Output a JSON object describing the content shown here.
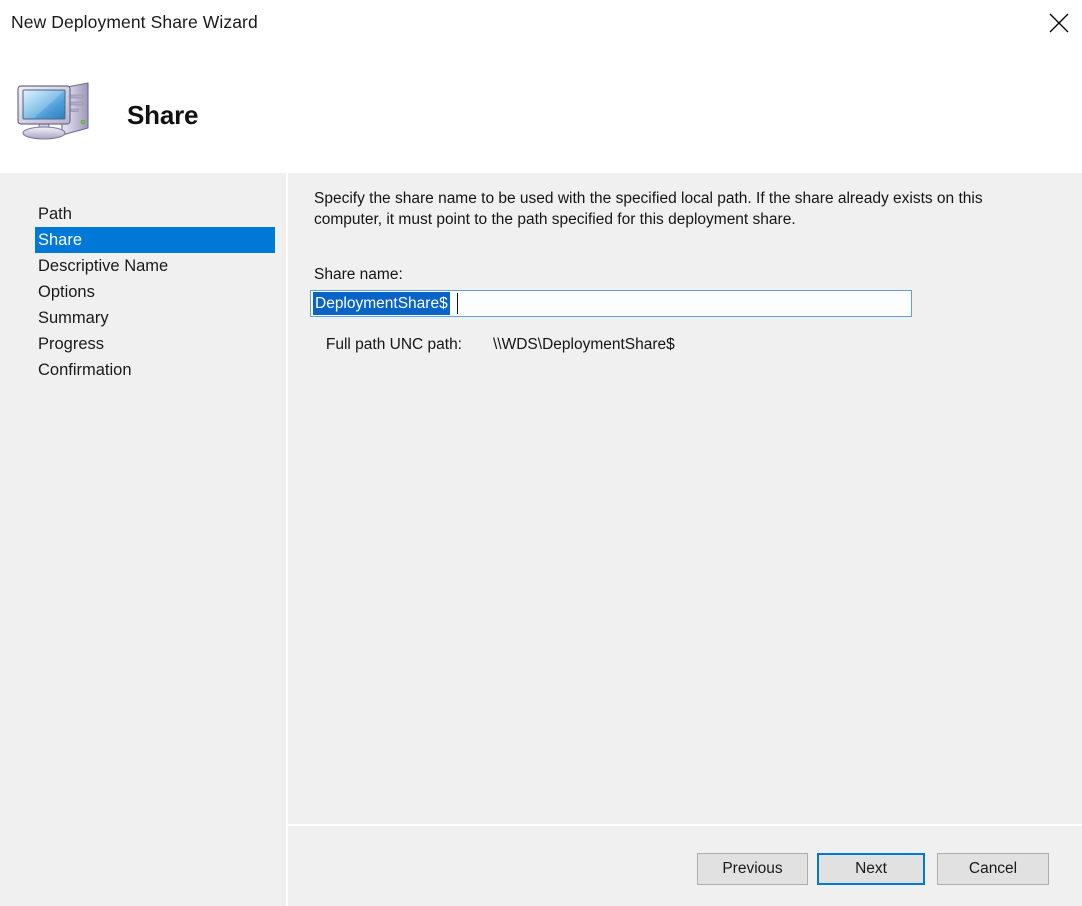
{
  "window": {
    "title": "New Deployment Share Wizard",
    "close_icon": "close-icon"
  },
  "header": {
    "icon": "computer-icon",
    "title": "Share"
  },
  "sidebar": {
    "items": [
      {
        "label": "Path",
        "active": false
      },
      {
        "label": "Share",
        "active": true
      },
      {
        "label": "Descriptive Name",
        "active": false
      },
      {
        "label": "Options",
        "active": false
      },
      {
        "label": "Summary",
        "active": false
      },
      {
        "label": "Progress",
        "active": false
      },
      {
        "label": "Confirmation",
        "active": false
      }
    ]
  },
  "content": {
    "description": "Specify the share name to be used with the specified local path.  If the share already exists on this computer, it must point to the path specified for this deployment share.",
    "share_name_label": "Share name:",
    "share_name_value": "DeploymentShare$",
    "unc_label": "Full path UNC path:",
    "unc_value": "\\\\WDS\\DeploymentShare$"
  },
  "footer": {
    "previous_label": "Previous",
    "next_label": "Next",
    "cancel_label": "Cancel"
  },
  "colors": {
    "accent": "#0078d7",
    "selection": "#0a64c8",
    "body_bg": "#f0f0f0",
    "header_bg": "#ffffff",
    "button_bg": "#e1e1e1"
  }
}
